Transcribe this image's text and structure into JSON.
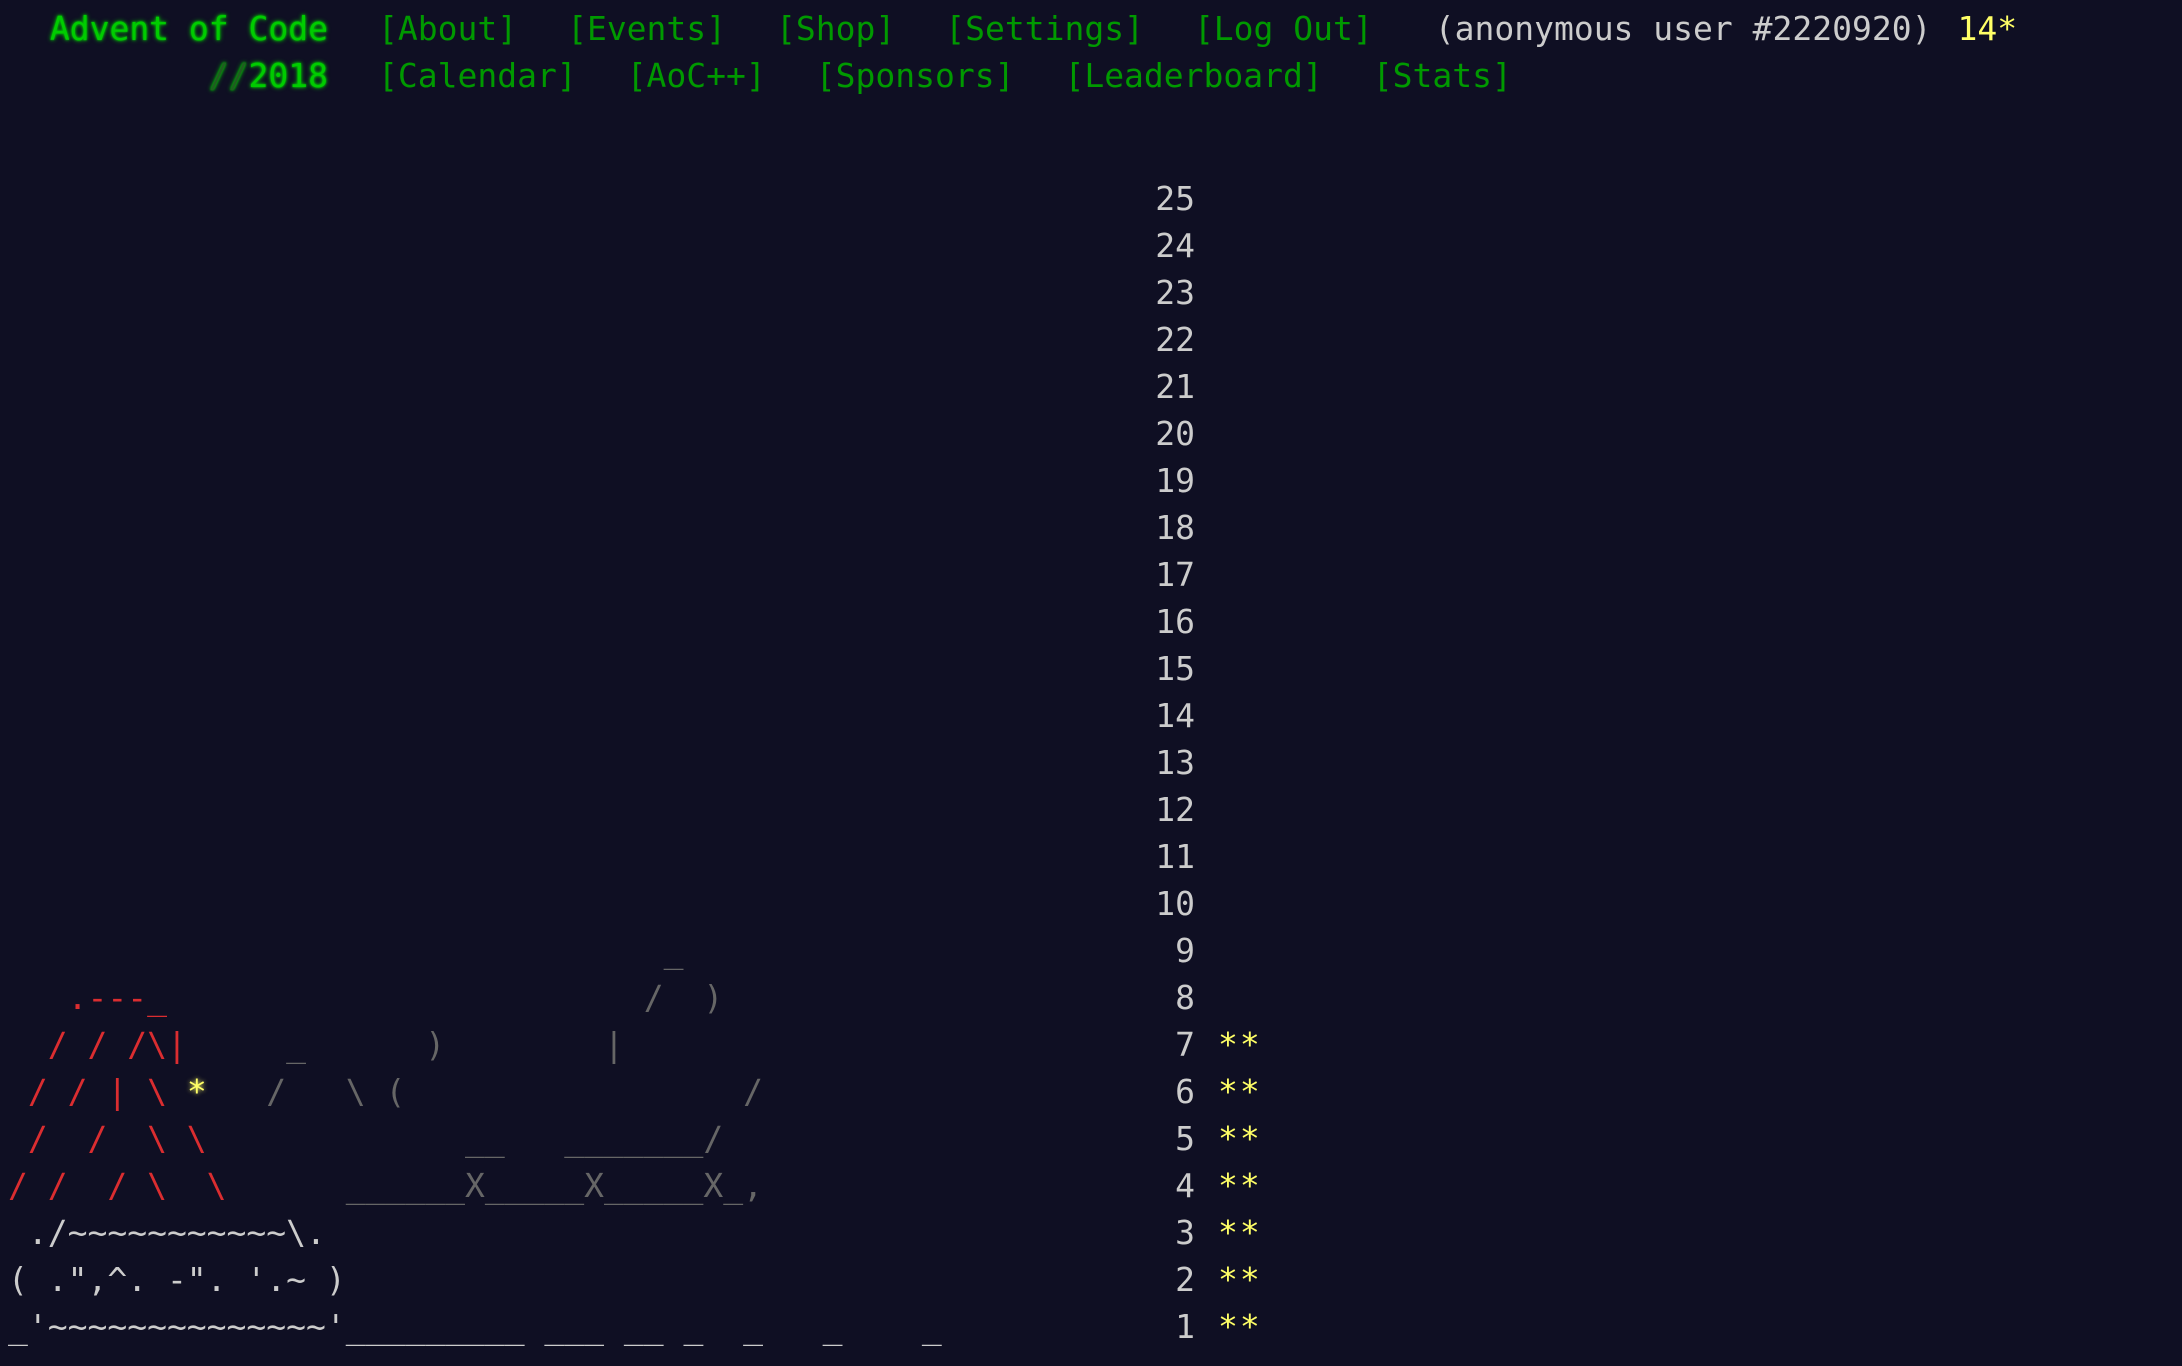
{
  "header": {
    "title": "Advent of Code",
    "year_prefix": "//",
    "year": "2018",
    "nav_row1": [
      "[About]",
      "[Events]",
      "[Shop]",
      "[Settings]",
      "[Log Out]"
    ],
    "user": "(anonymous user #2220920)",
    "stars": "14*",
    "nav_row2": [
      "[Calendar]",
      "[AoC++]",
      "[Sponsors]",
      "[Leaderboard]",
      "[Stats]"
    ]
  },
  "calendar": {
    "days": [
      {
        "day": "25",
        "stars": ""
      },
      {
        "day": "24",
        "stars": ""
      },
      {
        "day": "23",
        "stars": ""
      },
      {
        "day": "22",
        "stars": ""
      },
      {
        "day": "21",
        "stars": ""
      },
      {
        "day": "20",
        "stars": ""
      },
      {
        "day": "19",
        "stars": ""
      },
      {
        "day": "18",
        "stars": ""
      },
      {
        "day": "17",
        "stars": ""
      },
      {
        "day": "16",
        "stars": ""
      },
      {
        "day": "15",
        "stars": ""
      },
      {
        "day": "14",
        "stars": ""
      },
      {
        "day": "13",
        "stars": ""
      },
      {
        "day": "12",
        "stars": ""
      },
      {
        "day": "11",
        "stars": ""
      },
      {
        "day": "10",
        "stars": ""
      },
      {
        "day": "9",
        "stars": ""
      },
      {
        "day": "8",
        "stars": ""
      },
      {
        "day": "7",
        "stars": "**"
      },
      {
        "day": "6",
        "stars": "**"
      },
      {
        "day": "5",
        "stars": "**"
      },
      {
        "day": "4",
        "stars": "**"
      },
      {
        "day": "3",
        "stars": "**"
      },
      {
        "day": "2",
        "stars": "**"
      },
      {
        "day": "1",
        "stars": "**"
      }
    ],
    "art": {
      "l9": "                                 _",
      "l8_red": "   .---_",
      "l8_grey": "                        /  )",
      "l7_red": "  / / /\\|",
      "l7_grey": "     _      )        |",
      "l6_red": " / / | \\ ",
      "l6_star": "*",
      "l6_grey": "   /   \\ (                 /",
      "l5_red": " /  /  \\ \\",
      "l5_grey": "             __   _______/",
      "l4_red": "/ /  / \\  \\",
      "l4_grey": "      ______X_____X_____X_,",
      "l3": " ./~~~~~~~~~~~\\.",
      "l2": "( .\",^. -\". '.~ )",
      "l1": "_'~~~~~~~~~~~~~~'_________ ___ __ _  _   _    _"
    },
    "colors": {
      "background": "#0f0f23",
      "title_green": "#00cc00",
      "nav_green": "#009900",
      "star_yellow": "#ffff66",
      "art_red": "#ff3333",
      "art_grey": "#606060"
    }
  }
}
